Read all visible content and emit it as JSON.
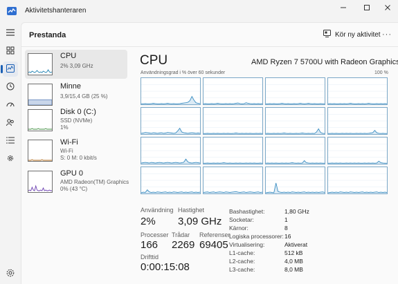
{
  "window": {
    "title": "Aktivitetshanteraren",
    "accent": "#1a5fb4"
  },
  "header": {
    "title": "Prestanda",
    "run_task": "Kör ny aktivitet"
  },
  "nav": [
    {
      "name": "hamburger-icon"
    },
    {
      "name": "processes-icon"
    },
    {
      "name": "performance-icon",
      "active": true
    },
    {
      "name": "app-history-icon"
    },
    {
      "name": "startup-icon"
    },
    {
      "name": "users-icon"
    },
    {
      "name": "details-icon"
    },
    {
      "name": "services-icon"
    },
    {
      "name": "settings-icon"
    }
  ],
  "resources": [
    {
      "name": "CPU",
      "sub1": "2% 3,09 GHz",
      "sub2": "",
      "sub3": "",
      "color": "#1a7fb0",
      "selected": true
    },
    {
      "name": "Minne",
      "sub1": "3,9/15,4 GB (25 %)",
      "sub2": "",
      "sub3": "",
      "color": "#7a5fb0",
      "level": 0.25
    },
    {
      "name": "Disk 0 (C:)",
      "sub1": "SSD (NVMe)",
      "sub2": "1%",
      "sub3": "",
      "color": "#3d8a3d"
    },
    {
      "name": "Wi-Fi",
      "sub1": "Wi-Fi",
      "sub2": "S: 0 M: 0 kbit/s",
      "sub3": "",
      "color": "#b06a1a"
    },
    {
      "name": "GPU 0",
      "sub1": "AMD Radeon(TM) Graphics",
      "sub2": "0% (43 °C)",
      "sub3": "",
      "color": "#6a3db0"
    }
  ],
  "cpu": {
    "title": "CPU",
    "model": "AMD Ryzen 7 5700U with Radeon Graphics",
    "usage_label": "Användningsgrad i % över 60 sekunder",
    "max_label": "100 %",
    "line_color": "#3b8ec2",
    "fill_color": "#dbeaf5"
  },
  "stats": {
    "usage_label": "Användning",
    "usage_value": "2%",
    "speed_label": "Hastighet",
    "speed_value": "3,09 GHz",
    "processes_label": "Processer",
    "processes_value": "166",
    "threads_label": "Trådar",
    "threads_value": "2269",
    "handles_label": "Referenser",
    "handles_value": "69405",
    "uptime_label": "Drifttid",
    "uptime_value": "0:00:15:08"
  },
  "specs": [
    {
      "label": "Bashastighet:",
      "value": "1,80 GHz"
    },
    {
      "label": "Socketar:",
      "value": "1"
    },
    {
      "label": "Kärnor:",
      "value": "8"
    },
    {
      "label": "Logiska processorer:",
      "value": "16"
    },
    {
      "label": "Virtualisering:",
      "value": "Aktiverat"
    },
    {
      "label": "L1-cache:",
      "value": "512 kB"
    },
    {
      "label": "L2-cache:",
      "value": "4,0 MB"
    },
    {
      "label": "L3-cache:",
      "value": "8,0 MB"
    }
  ],
  "core_series": [
    [
      2,
      2,
      3,
      2,
      2,
      3,
      4,
      3,
      2,
      2,
      3,
      2,
      3,
      4,
      3,
      2,
      3,
      2,
      2,
      3,
      4,
      5,
      6,
      8,
      14,
      30,
      16,
      6,
      4,
      3
    ],
    [
      2,
      3,
      2,
      2,
      3,
      2,
      3,
      4,
      3,
      2,
      2,
      3,
      2,
      3,
      2,
      3,
      4,
      5,
      3,
      2,
      3,
      6,
      4,
      3,
      2,
      3,
      2,
      3,
      2,
      3
    ],
    [
      2,
      2,
      3,
      2,
      3,
      2,
      2,
      3,
      4,
      3,
      2,
      3,
      2,
      2,
      3,
      2,
      3,
      4,
      3,
      2,
      3,
      4,
      3,
      2,
      3,
      2,
      2,
      3,
      2,
      2
    ],
    [
      2,
      3,
      2,
      3,
      2,
      2,
      3,
      2,
      3,
      2,
      3,
      4,
      3,
      2,
      2,
      3,
      2,
      3,
      2,
      3,
      4,
      3,
      2,
      2,
      3,
      2,
      3,
      2,
      3,
      2
    ],
    [
      3,
      4,
      6,
      5,
      4,
      3,
      5,
      4,
      3,
      4,
      5,
      3,
      4,
      6,
      5,
      4,
      3,
      4,
      12,
      22,
      8,
      5,
      4,
      3,
      4,
      5,
      4,
      3,
      4,
      3
    ],
    [
      2,
      2,
      3,
      2,
      2,
      3,
      2,
      3,
      2,
      2,
      3,
      2,
      3,
      2,
      2,
      3,
      4,
      3,
      2,
      3,
      2,
      3,
      2,
      3,
      2,
      2,
      3,
      2,
      3,
      2
    ],
    [
      2,
      3,
      2,
      2,
      3,
      2,
      3,
      2,
      3,
      4,
      3,
      2,
      3,
      2,
      2,
      3,
      2,
      3,
      4,
      3,
      2,
      3,
      2,
      3,
      2,
      8,
      20,
      6,
      3,
      2
    ],
    [
      2,
      2,
      3,
      2,
      3,
      2,
      2,
      3,
      2,
      3,
      2,
      3,
      2,
      2,
      3,
      2,
      3,
      2,
      3,
      2,
      3,
      4,
      5,
      14,
      5,
      3,
      2,
      3,
      2,
      2
    ],
    [
      3,
      4,
      5,
      4,
      3,
      5,
      4,
      3,
      4,
      5,
      4,
      3,
      4,
      5,
      4,
      3,
      4,
      5,
      4,
      3,
      4,
      6,
      18,
      7,
      4,
      3,
      4,
      5,
      4,
      3
    ],
    [
      2,
      2,
      3,
      2,
      2,
      3,
      2,
      3,
      2,
      3,
      4,
      3,
      2,
      3,
      2,
      2,
      3,
      2,
      3,
      2,
      2,
      3,
      2,
      3,
      2,
      3,
      2,
      2,
      3,
      2
    ],
    [
      2,
      3,
      2,
      3,
      2,
      3,
      2,
      2,
      3,
      2,
      3,
      2,
      3,
      4,
      3,
      2,
      3,
      2,
      3,
      12,
      4,
      3,
      2,
      3,
      2,
      3,
      2,
      3,
      2,
      2
    ],
    [
      2,
      2,
      3,
      2,
      3,
      2,
      3,
      2,
      2,
      3,
      2,
      3,
      2,
      3,
      2,
      3,
      2,
      2,
      3,
      2,
      3,
      2,
      3,
      2,
      3,
      10,
      4,
      3,
      2,
      2
    ],
    [
      3,
      5,
      4,
      14,
      6,
      4,
      5,
      4,
      6,
      5,
      4,
      5,
      6,
      4,
      5,
      4,
      6,
      5,
      4,
      5,
      6,
      4,
      5,
      4,
      5,
      6,
      4,
      5,
      4,
      5
    ],
    [
      4,
      5,
      6,
      4,
      5,
      6,
      4,
      5,
      6,
      5,
      4,
      6,
      5,
      4,
      5,
      6,
      7,
      5,
      4,
      5,
      6,
      4,
      5,
      6,
      5,
      4,
      5,
      6,
      4,
      5
    ],
    [
      3,
      4,
      5,
      4,
      3,
      40,
      8,
      5,
      4,
      5,
      4,
      5,
      4,
      6,
      5,
      4,
      5,
      4,
      5,
      6,
      4,
      5,
      4,
      5,
      4,
      5,
      4,
      5,
      6,
      4
    ],
    [
      3,
      4,
      5,
      4,
      5,
      4,
      6,
      5,
      4,
      5,
      4,
      6,
      5,
      4,
      5,
      4,
      5,
      6,
      4,
      5,
      4,
      5,
      4,
      5,
      6,
      4,
      5,
      4,
      5,
      4
    ]
  ]
}
